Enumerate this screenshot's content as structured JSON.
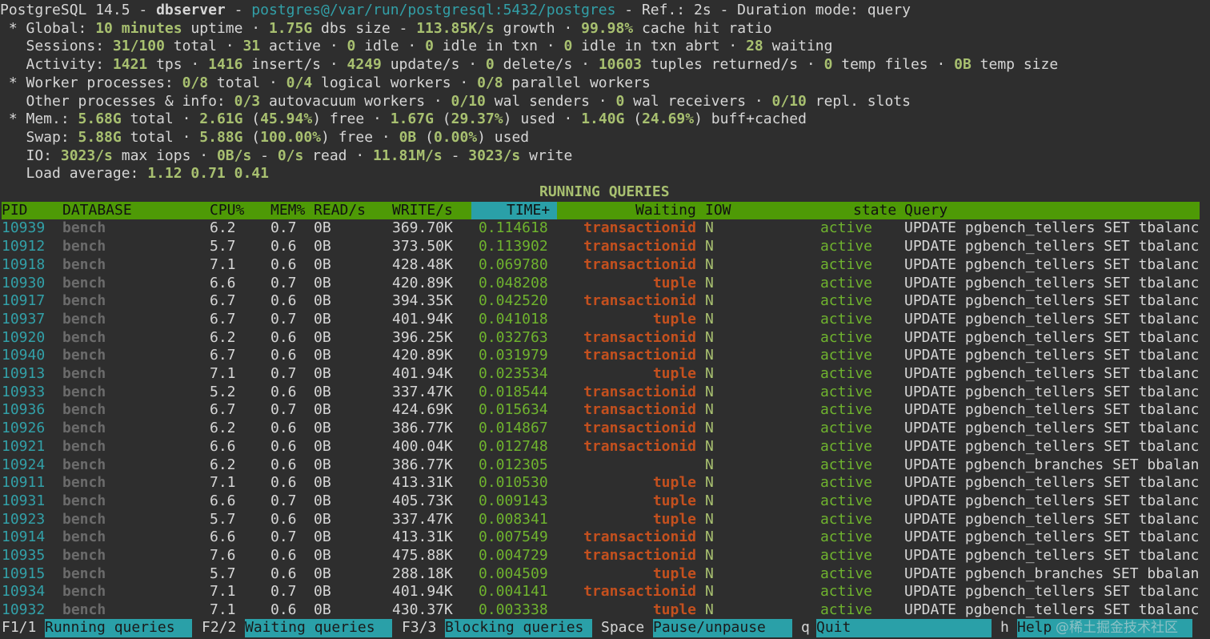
{
  "header": {
    "line1": {
      "version": "PostgreSQL 14.5",
      "sep1": " - ",
      "host": "dbserver",
      "sep2": " - ",
      "conn": "postgres@/var/run/postgresql:5432/postgres",
      "rest": " - Ref.: 2s - Duration mode: query"
    },
    "global": {
      "prefix": " * Global: ",
      "uptime": "10 minutes",
      "t1": " uptime · ",
      "dbsize": "1.75G",
      "t2": " dbs size - ",
      "growth": "113.85K/s",
      "t3": " growth · ",
      "hit": "99.98%",
      "t4": " cache hit ratio"
    },
    "sessions": {
      "prefix": "   Sessions: ",
      "total": "31/100",
      "t1": " total · ",
      "active": "31",
      "t2": " active · ",
      "idle": "0",
      "t3": " idle · ",
      "idle_txn": "0",
      "t4": " idle in txn · ",
      "idle_abrt": "0",
      "t5": " idle in txn abrt · ",
      "waiting": "28",
      "t6": " waiting"
    },
    "activity": {
      "prefix": "   Activity: ",
      "tps": "1421",
      "t1": " tps · ",
      "insert": "1416",
      "t2": " insert/s · ",
      "update": "4249",
      "t3": " update/s · ",
      "delete": "0",
      "t4": " delete/s · ",
      "tuples": "10603",
      "t5": " tuples returned/s · ",
      "tempfiles": "0",
      "t6": " temp files · ",
      "tempsize": "0B",
      "t7": " temp size"
    },
    "workers": {
      "prefix": " * Worker processes: ",
      "total": "0/8",
      "t1": " total · ",
      "logical": "0/4",
      "t2": " logical workers · ",
      "parallel": "0/8",
      "t3": " parallel workers"
    },
    "other": {
      "prefix": "   Other processes & info: ",
      "autovac": "0/3",
      "t1": " autovacuum workers · ",
      "walsend": "0/10",
      "t2": " wal senders · ",
      "walrecv": "0",
      "t3": " wal receivers · ",
      "slots": "0/10",
      "t4": " repl. slots"
    },
    "mem": {
      "prefix": " * Mem.: ",
      "total": "5.68G",
      "t1": " total · ",
      "free": "2.61G",
      "t2": " (",
      "freepct": "45.94%",
      "t3": ") free · ",
      "used": "1.67G",
      "t4": " (",
      "usedpct": "29.37%",
      "t5": ") used · ",
      "buff": "1.40G",
      "t6": " (",
      "buffpct": "24.69%",
      "t7": ") buff+cached"
    },
    "swap": {
      "prefix": "   Swap: ",
      "total": "5.88G",
      "t1": " total · ",
      "free": "5.88G",
      "t2": " (",
      "freepct": "100.00%",
      "t3": ") free · ",
      "used": "0B",
      "t4": " (",
      "usedpct": "0.00%",
      "t5": ") used"
    },
    "io": {
      "prefix": "   IO: ",
      "iops": "3023/s",
      "t1": " max iops · ",
      "read_b": "0B/s",
      "t2": " - ",
      "read_o": "0/s",
      "t3": " read · ",
      "write_b": "11.81M/s",
      "t4": " - ",
      "write_o": "3023/s",
      "t5": " write"
    },
    "load": {
      "prefix": "   Load average: ",
      "values": "1.12 0.71 0.41"
    }
  },
  "section_title": "RUNNING QUERIES",
  "columns": {
    "pid": "PID",
    "database": "DATABASE",
    "cpu": "CPU%",
    "mem": "MEM%",
    "read": "READ/s",
    "write": "WRITE/s",
    "time": "TIME+",
    "waiting": "Waiting",
    "iow": "IOW",
    "state": "state",
    "query": "Query"
  },
  "rows": [
    {
      "pid": "10939",
      "db": "bench",
      "cpu": "6.2",
      "mem": "0.7",
      "read": "0B",
      "write": "369.70K",
      "time": "0.114618",
      "wait": "transactionid",
      "iow": "N",
      "state": "active",
      "query": "UPDATE pgbench_tellers SET tbalanc"
    },
    {
      "pid": "10912",
      "db": "bench",
      "cpu": "5.7",
      "mem": "0.6",
      "read": "0B",
      "write": "373.50K",
      "time": "0.113902",
      "wait": "transactionid",
      "iow": "N",
      "state": "active",
      "query": "UPDATE pgbench_tellers SET tbalanc"
    },
    {
      "pid": "10918",
      "db": "bench",
      "cpu": "7.1",
      "mem": "0.6",
      "read": "0B",
      "write": "428.48K",
      "time": "0.069780",
      "wait": "transactionid",
      "iow": "N",
      "state": "active",
      "query": "UPDATE pgbench_tellers SET tbalanc"
    },
    {
      "pid": "10930",
      "db": "bench",
      "cpu": "6.6",
      "mem": "0.7",
      "read": "0B",
      "write": "420.89K",
      "time": "0.048208",
      "wait": "tuple",
      "iow": "N",
      "state": "active",
      "query": "UPDATE pgbench_tellers SET tbalanc"
    },
    {
      "pid": "10917",
      "db": "bench",
      "cpu": "6.7",
      "mem": "0.6",
      "read": "0B",
      "write": "394.35K",
      "time": "0.042520",
      "wait": "transactionid",
      "iow": "N",
      "state": "active",
      "query": "UPDATE pgbench_tellers SET tbalanc"
    },
    {
      "pid": "10937",
      "db": "bench",
      "cpu": "6.7",
      "mem": "0.7",
      "read": "0B",
      "write": "401.94K",
      "time": "0.041018",
      "wait": "tuple",
      "iow": "N",
      "state": "active",
      "query": "UPDATE pgbench_tellers SET tbalanc"
    },
    {
      "pid": "10920",
      "db": "bench",
      "cpu": "6.2",
      "mem": "0.6",
      "read": "0B",
      "write": "396.25K",
      "time": "0.032763",
      "wait": "transactionid",
      "iow": "N",
      "state": "active",
      "query": "UPDATE pgbench_tellers SET tbalanc"
    },
    {
      "pid": "10940",
      "db": "bench",
      "cpu": "6.7",
      "mem": "0.6",
      "read": "0B",
      "write": "420.89K",
      "time": "0.031979",
      "wait": "transactionid",
      "iow": "N",
      "state": "active",
      "query": "UPDATE pgbench_tellers SET tbalanc"
    },
    {
      "pid": "10913",
      "db": "bench",
      "cpu": "7.1",
      "mem": "0.7",
      "read": "0B",
      "write": "401.94K",
      "time": "0.023534",
      "wait": "tuple",
      "iow": "N",
      "state": "active",
      "query": "UPDATE pgbench_tellers SET tbalanc"
    },
    {
      "pid": "10933",
      "db": "bench",
      "cpu": "5.2",
      "mem": "0.6",
      "read": "0B",
      "write": "337.47K",
      "time": "0.018544",
      "wait": "transactionid",
      "iow": "N",
      "state": "active",
      "query": "UPDATE pgbench_tellers SET tbalanc"
    },
    {
      "pid": "10936",
      "db": "bench",
      "cpu": "6.7",
      "mem": "0.7",
      "read": "0B",
      "write": "424.69K",
      "time": "0.015634",
      "wait": "transactionid",
      "iow": "N",
      "state": "active",
      "query": "UPDATE pgbench_tellers SET tbalanc"
    },
    {
      "pid": "10926",
      "db": "bench",
      "cpu": "6.2",
      "mem": "0.6",
      "read": "0B",
      "write": "386.77K",
      "time": "0.014867",
      "wait": "transactionid",
      "iow": "N",
      "state": "active",
      "query": "UPDATE pgbench_tellers SET tbalanc"
    },
    {
      "pid": "10921",
      "db": "bench",
      "cpu": "6.6",
      "mem": "0.6",
      "read": "0B",
      "write": "400.04K",
      "time": "0.012748",
      "wait": "transactionid",
      "iow": "N",
      "state": "active",
      "query": "UPDATE pgbench_tellers SET tbalanc"
    },
    {
      "pid": "10924",
      "db": "bench",
      "cpu": "6.2",
      "mem": "0.6",
      "read": "0B",
      "write": "386.77K",
      "time": "0.012305",
      "wait": "",
      "iow": "N",
      "state": "active",
      "query": "UPDATE pgbench_branches SET bbalan"
    },
    {
      "pid": "10911",
      "db": "bench",
      "cpu": "7.1",
      "mem": "0.6",
      "read": "0B",
      "write": "413.31K",
      "time": "0.010530",
      "wait": "tuple",
      "iow": "N",
      "state": "active",
      "query": "UPDATE pgbench_tellers SET tbalanc"
    },
    {
      "pid": "10931",
      "db": "bench",
      "cpu": "6.6",
      "mem": "0.7",
      "read": "0B",
      "write": "405.73K",
      "time": "0.009143",
      "wait": "tuple",
      "iow": "N",
      "state": "active",
      "query": "UPDATE pgbench_tellers SET tbalanc"
    },
    {
      "pid": "10923",
      "db": "bench",
      "cpu": "5.7",
      "mem": "0.6",
      "read": "0B",
      "write": "337.47K",
      "time": "0.008341",
      "wait": "tuple",
      "iow": "N",
      "state": "active",
      "query": "UPDATE pgbench_tellers SET tbalanc"
    },
    {
      "pid": "10914",
      "db": "bench",
      "cpu": "6.6",
      "mem": "0.7",
      "read": "0B",
      "write": "413.31K",
      "time": "0.007549",
      "wait": "transactionid",
      "iow": "N",
      "state": "active",
      "query": "UPDATE pgbench_tellers SET tbalanc"
    },
    {
      "pid": "10935",
      "db": "bench",
      "cpu": "7.6",
      "mem": "0.6",
      "read": "0B",
      "write": "475.88K",
      "time": "0.004729",
      "wait": "transactionid",
      "iow": "N",
      "state": "active",
      "query": "UPDATE pgbench_tellers SET tbalanc"
    },
    {
      "pid": "10915",
      "db": "bench",
      "cpu": "5.7",
      "mem": "0.6",
      "read": "0B",
      "write": "288.18K",
      "time": "0.004509",
      "wait": "tuple",
      "iow": "N",
      "state": "active",
      "query": "UPDATE pgbench_branches SET bbalan"
    },
    {
      "pid": "10934",
      "db": "bench",
      "cpu": "7.1",
      "mem": "0.7",
      "read": "0B",
      "write": "401.94K",
      "time": "0.004141",
      "wait": "transactionid",
      "iow": "N",
      "state": "active",
      "query": "UPDATE pgbench_tellers SET tbalanc"
    },
    {
      "pid": "10932",
      "db": "bench",
      "cpu": "7.1",
      "mem": "0.6",
      "read": "0B",
      "write": "430.37K",
      "time": "0.003338",
      "wait": "tuple",
      "iow": "N",
      "state": "active",
      "query": "UPDATE pgbench_tellers SET tbalanc"
    }
  ],
  "footer": {
    "k1": "F1/1",
    "l1": "Running queries",
    "k2": "F2/2",
    "l2": "Waiting queries",
    "k3": "F3/3",
    "l3": "Blocking queries",
    "k4": "Space",
    "l4": "Pause/unpause",
    "k5": "q",
    "l5": "Quit",
    "k6": "h",
    "l6": "Help",
    "watermark": "@稀土掘金技术社区"
  },
  "colors": {
    "background": "#2e2e2e",
    "header_bar": "#4e9a06",
    "highlight": "#2aa0a8",
    "value_green": "#a8c070",
    "wait_red": "#c4501e",
    "pid_cyan": "#32a0a8"
  }
}
